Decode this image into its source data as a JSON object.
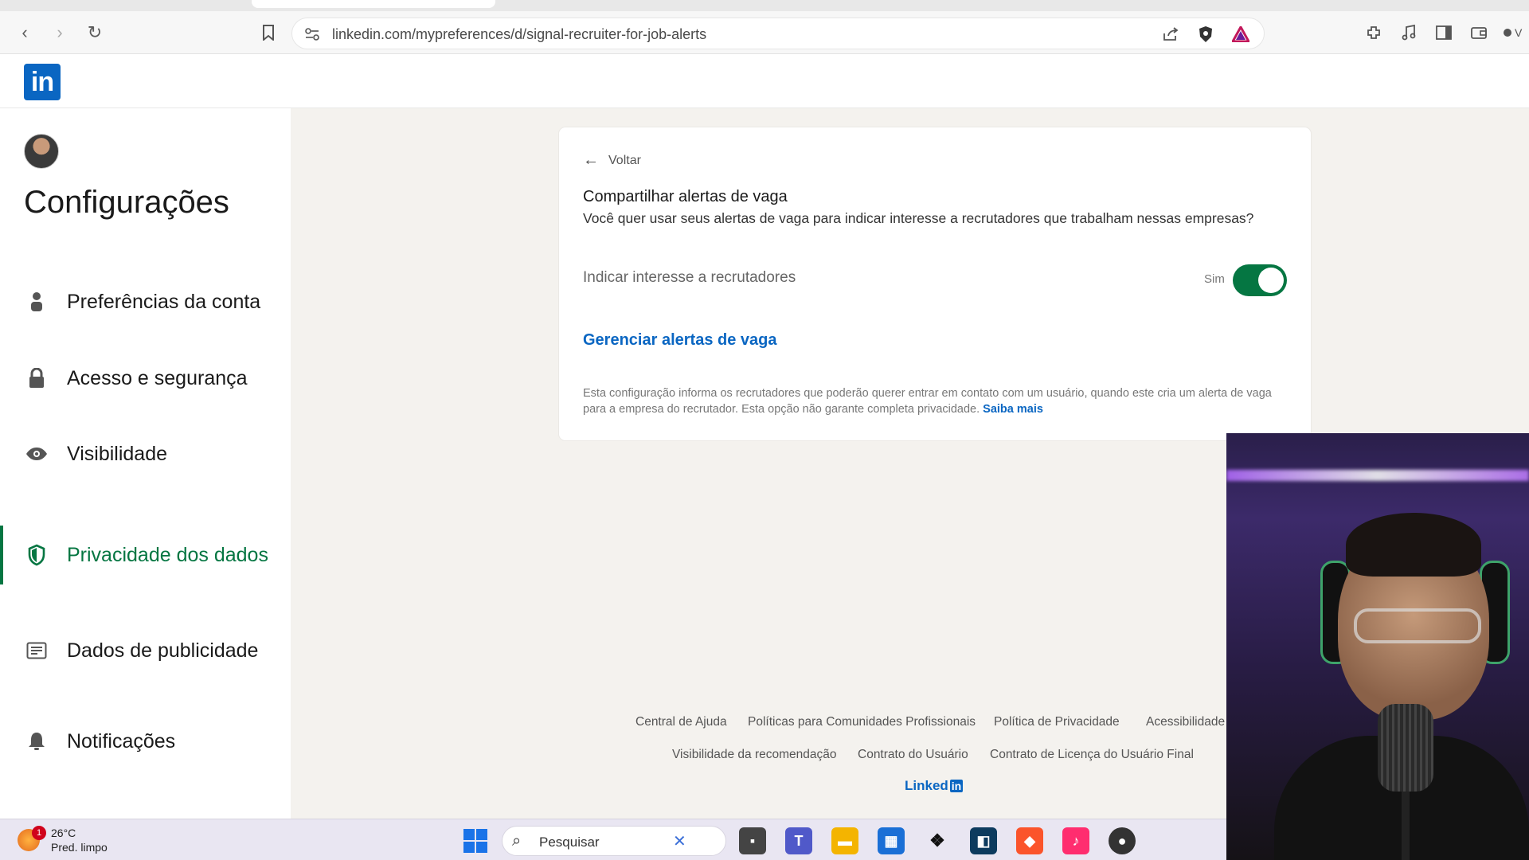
{
  "browser": {
    "url": "linkedin.com/mypreferences/d/signal-recruiter-for-job-alerts",
    "extension_partial_label": "V"
  },
  "sidebar": {
    "title": "Configurações",
    "items": [
      {
        "label": "Preferências da conta",
        "icon": "person-icon"
      },
      {
        "label": "Acesso e segurança",
        "icon": "lock-icon"
      },
      {
        "label": "Visibilidade",
        "icon": "eye-icon"
      },
      {
        "label": "Privacidade dos dados",
        "icon": "shield-icon",
        "active": true
      },
      {
        "label": "Dados de publicidade",
        "icon": "newspaper-icon"
      },
      {
        "label": "Notificações",
        "icon": "bell-icon"
      }
    ]
  },
  "card": {
    "back_label": "Voltar",
    "title": "Compartilhar alertas de vaga",
    "description": "Você quer usar seus alertas de vaga para indicar interesse a recrutadores que trabalham nessas empresas?",
    "setting_label": "Indicar interesse a recrutadores",
    "toggle_state": "Sim",
    "toggle_on": true,
    "manage_link": "Gerenciar alertas de vaga",
    "note": "Esta configuração informa os recrutadores que poderão querer entrar em contato com um usuário, quando este cria um alerta de vaga para a empresa do recrutador. Esta opção não garante completa privacidade.",
    "note_link": "Saiba mais"
  },
  "footer": {
    "row1": [
      "Central de Ajuda",
      "Políticas para Comunidades Profissionais",
      "Política de Privacidade",
      "Acessibilidade"
    ],
    "row2": [
      "Visibilidade da recomendação",
      "Contrato do Usuário",
      "Contrato de Licença do Usuário Final"
    ],
    "logo_text": "Linked",
    "logo_in": "in"
  },
  "taskbar": {
    "weather_badge": "1",
    "temperature": "26°C",
    "condition": "Pred. limpo",
    "search_placeholder": "Pesquisar"
  },
  "colors": {
    "linkedin_blue": "#0a66c2",
    "linkedin_green": "#057642"
  }
}
